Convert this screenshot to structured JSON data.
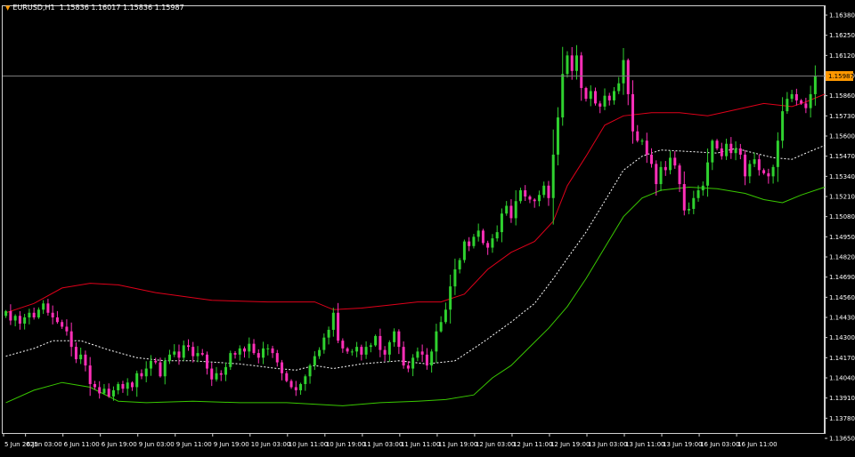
{
  "header": {
    "symbol": "EURUSD,H1",
    "ohlc": "1.15836 1.16017 1.15836 1.15987"
  },
  "price_label": "1.15987",
  "colors": {
    "background": "#000000",
    "frame": "#d0d0d0",
    "bull": "#2fd12f",
    "bear": "#ff2fb8",
    "upper_band": "#e0001a",
    "middle_band": "#ffffff",
    "lower_band": "#39c800",
    "price_line": "#7a7a7a",
    "price_label_bg": "#ff9800",
    "axis_text": "#ffffff"
  },
  "chart_data": {
    "type": "candlestick",
    "symbol": "EURUSD",
    "timeframe": "H1",
    "ylim": [
      1.1365,
      1.1638
    ],
    "y_ticks": [
      "1.16380",
      "1.16250",
      "1.16120",
      "1.15990",
      "1.15860",
      "1.15730",
      "1.15600",
      "1.15470",
      "1.15340",
      "1.15210",
      "1.15080",
      "1.14950",
      "1.14820",
      "1.14690",
      "1.14560",
      "1.14430",
      "1.14300",
      "1.14170",
      "1.14040",
      "1.13910",
      "1.13780",
      "1.13650"
    ],
    "x_ticks": [
      "5 Jun 2025",
      "6 Jun 03:00",
      "6 Jun 11:00",
      "6 Jun 19:00",
      "9 Jun 03:00",
      "9 Jun 11:00",
      "9 Jun 19:00",
      "10 Jun 03:00",
      "10 Jun 11:00",
      "10 Jun 19:00",
      "11 Jun 03:00",
      "11 Jun 11:00",
      "11 Jun 19:00",
      "12 Jun 03:00",
      "12 Jun 11:00",
      "12 Jun 19:00",
      "13 Jun 03:00",
      "13 Jun 11:00",
      "13 Jun 19:00",
      "16 Jun 03:00",
      "16 Jun 11:00"
    ],
    "current_price": 1.15987,
    "close": [
      1.1447,
      1.1441,
      1.1444,
      1.1439,
      1.1443,
      1.1446,
      1.1443,
      1.1448,
      1.1452,
      1.1446,
      1.1443,
      1.144,
      1.1437,
      1.1434,
      1.1424,
      1.1416,
      1.1419,
      1.1412,
      1.14,
      1.1398,
      1.1394,
      1.1397,
      1.1392,
      1.1396,
      1.14,
      1.1397,
      1.1401,
      1.1398,
      1.1407,
      1.1405,
      1.141,
      1.1415,
      1.1414,
      1.1405,
      1.1415,
      1.1419,
      1.1421,
      1.1417,
      1.1425,
      1.1424,
      1.1418,
      1.142,
      1.1419,
      1.141,
      1.1403,
      1.1407,
      1.1406,
      1.1411,
      1.142,
      1.1419,
      1.1423,
      1.1421,
      1.1426,
      1.142,
      1.1417,
      1.1423,
      1.1423,
      1.142,
      1.1414,
      1.1407,
      1.1402,
      1.1398,
      1.1396,
      1.14,
      1.1405,
      1.1412,
      1.1418,
      1.1422,
      1.143,
      1.1435,
      1.1446,
      1.1428,
      1.1423,
      1.1421,
      1.1421,
      1.1424,
      1.1419,
      1.1424,
      1.1425,
      1.1431,
      1.1422,
      1.1419,
      1.1427,
      1.1434,
      1.1424,
      1.1412,
      1.141,
      1.1417,
      1.1421,
      1.1419,
      1.1412,
      1.1421,
      1.1434,
      1.144,
      1.1448,
      1.1463,
      1.1474,
      1.148,
      1.1492,
      1.1489,
      1.1495,
      1.1499,
      1.1491,
      1.1488,
      1.1494,
      1.1498,
      1.151,
      1.1515,
      1.1507,
      1.1518,
      1.1525,
      1.1521,
      1.1519,
      1.1518,
      1.1522,
      1.1528,
      1.152,
      1.1548,
      1.1572,
      1.16,
      1.1612,
      1.1602,
      1.1612,
      1.1591,
      1.1584,
      1.1589,
      1.1581,
      1.1579,
      1.1586,
      1.1583,
      1.1589,
      1.1594,
      1.1609,
      1.1587,
      1.1563,
      1.1557,
      1.1557,
      1.1548,
      1.1542,
      1.1529,
      1.154,
      1.1538,
      1.1546,
      1.1541,
      1.1529,
      1.1512,
      1.1513,
      1.152,
      1.1525,
      1.1528,
      1.1543,
      1.1557,
      1.1552,
      1.1547,
      1.1555,
      1.1549,
      1.1552,
      1.1548,
      1.1534,
      1.1542,
      1.1545,
      1.1538,
      1.1536,
      1.1534,
      1.154,
      1.1557,
      1.1576,
      1.1584,
      1.1587,
      1.1583,
      1.1581,
      1.1578,
      1.1587,
      1.1599
    ],
    "bollinger": {
      "upper": [
        [
          0,
          1.1446
        ],
        [
          6,
          1.1452
        ],
        [
          12,
          1.1462
        ],
        [
          18,
          1.1465
        ],
        [
          24,
          1.1464
        ],
        [
          32,
          1.1459
        ],
        [
          44,
          1.1454
        ],
        [
          56,
          1.1453
        ],
        [
          66,
          1.1453
        ],
        [
          70,
          1.1448
        ],
        [
          76,
          1.1449
        ],
        [
          82,
          1.1451
        ],
        [
          88,
          1.1453
        ],
        [
          93,
          1.1453
        ],
        [
          98,
          1.1458
        ],
        [
          103,
          1.1474
        ],
        [
          108,
          1.1485
        ],
        [
          113,
          1.1492
        ],
        [
          117,
          1.1505
        ],
        [
          120,
          1.1528
        ],
        [
          124,
          1.1547
        ],
        [
          128,
          1.1567
        ],
        [
          132,
          1.1573
        ],
        [
          138,
          1.1575
        ],
        [
          144,
          1.1575
        ],
        [
          150,
          1.1573
        ],
        [
          156,
          1.1577
        ],
        [
          162,
          1.1581
        ],
        [
          168,
          1.1579
        ],
        [
          171,
          1.1582
        ],
        [
          175,
          1.1587
        ]
      ],
      "middle": [
        [
          0,
          1.1418
        ],
        [
          6,
          1.1423
        ],
        [
          10,
          1.1428
        ],
        [
          16,
          1.1428
        ],
        [
          22,
          1.1422
        ],
        [
          28,
          1.1417
        ],
        [
          34,
          1.1415
        ],
        [
          40,
          1.1415
        ],
        [
          50,
          1.1413
        ],
        [
          58,
          1.141
        ],
        [
          62,
          1.1409
        ],
        [
          66,
          1.1412
        ],
        [
          70,
          1.141
        ],
        [
          76,
          1.1413
        ],
        [
          84,
          1.1415
        ],
        [
          90,
          1.1413
        ],
        [
          96,
          1.1415
        ],
        [
          102,
          1.1427
        ],
        [
          108,
          1.144
        ],
        [
          113,
          1.1452
        ],
        [
          117,
          1.1468
        ],
        [
          120,
          1.1481
        ],
        [
          124,
          1.1498
        ],
        [
          128,
          1.1518
        ],
        [
          132,
          1.1538
        ],
        [
          136,
          1.1547
        ],
        [
          140,
          1.1551
        ],
        [
          146,
          1.155
        ],
        [
          152,
          1.1549
        ],
        [
          156,
          1.1552
        ],
        [
          160,
          1.1549
        ],
        [
          164,
          1.1546
        ],
        [
          168,
          1.1545
        ],
        [
          171,
          1.1549
        ],
        [
          175,
          1.1554
        ]
      ],
      "lower": [
        [
          0,
          1.1388
        ],
        [
          6,
          1.1396
        ],
        [
          12,
          1.1401
        ],
        [
          18,
          1.1398
        ],
        [
          24,
          1.1389
        ],
        [
          30,
          1.1388
        ],
        [
          40,
          1.1389
        ],
        [
          50,
          1.1388
        ],
        [
          60,
          1.1388
        ],
        [
          66,
          1.1387
        ],
        [
          72,
          1.1386
        ],
        [
          80,
          1.1388
        ],
        [
          88,
          1.1389
        ],
        [
          94,
          1.139
        ],
        [
          100,
          1.1393
        ],
        [
          104,
          1.1404
        ],
        [
          108,
          1.1412
        ],
        [
          112,
          1.1424
        ],
        [
          116,
          1.1436
        ],
        [
          120,
          1.145
        ],
        [
          124,
          1.1468
        ],
        [
          128,
          1.1488
        ],
        [
          132,
          1.1508
        ],
        [
          136,
          1.152
        ],
        [
          140,
          1.1525
        ],
        [
          146,
          1.1527
        ],
        [
          152,
          1.1526
        ],
        [
          158,
          1.1523
        ],
        [
          162,
          1.1519
        ],
        [
          166,
          1.1517
        ],
        [
          170,
          1.1522
        ],
        [
          175,
          1.1527
        ]
      ]
    }
  }
}
